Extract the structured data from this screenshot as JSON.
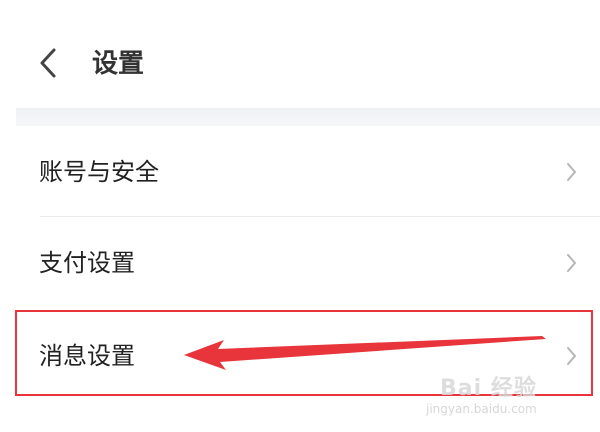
{
  "header": {
    "title": "设置",
    "back_icon": "chevron-left-icon"
  },
  "menu": {
    "items": [
      {
        "label": "账号与安全",
        "icon": "chevron-right-icon"
      },
      {
        "label": "支付设置",
        "icon": "chevron-right-icon"
      },
      {
        "label": "消息设置",
        "icon": "chevron-right-icon"
      }
    ]
  },
  "annotation": {
    "highlight_color": "#e8353b",
    "arrow_color": "#e8353b"
  },
  "watermark": {
    "logo": "Bai 经验",
    "url": "jingyan.baidu.com"
  }
}
